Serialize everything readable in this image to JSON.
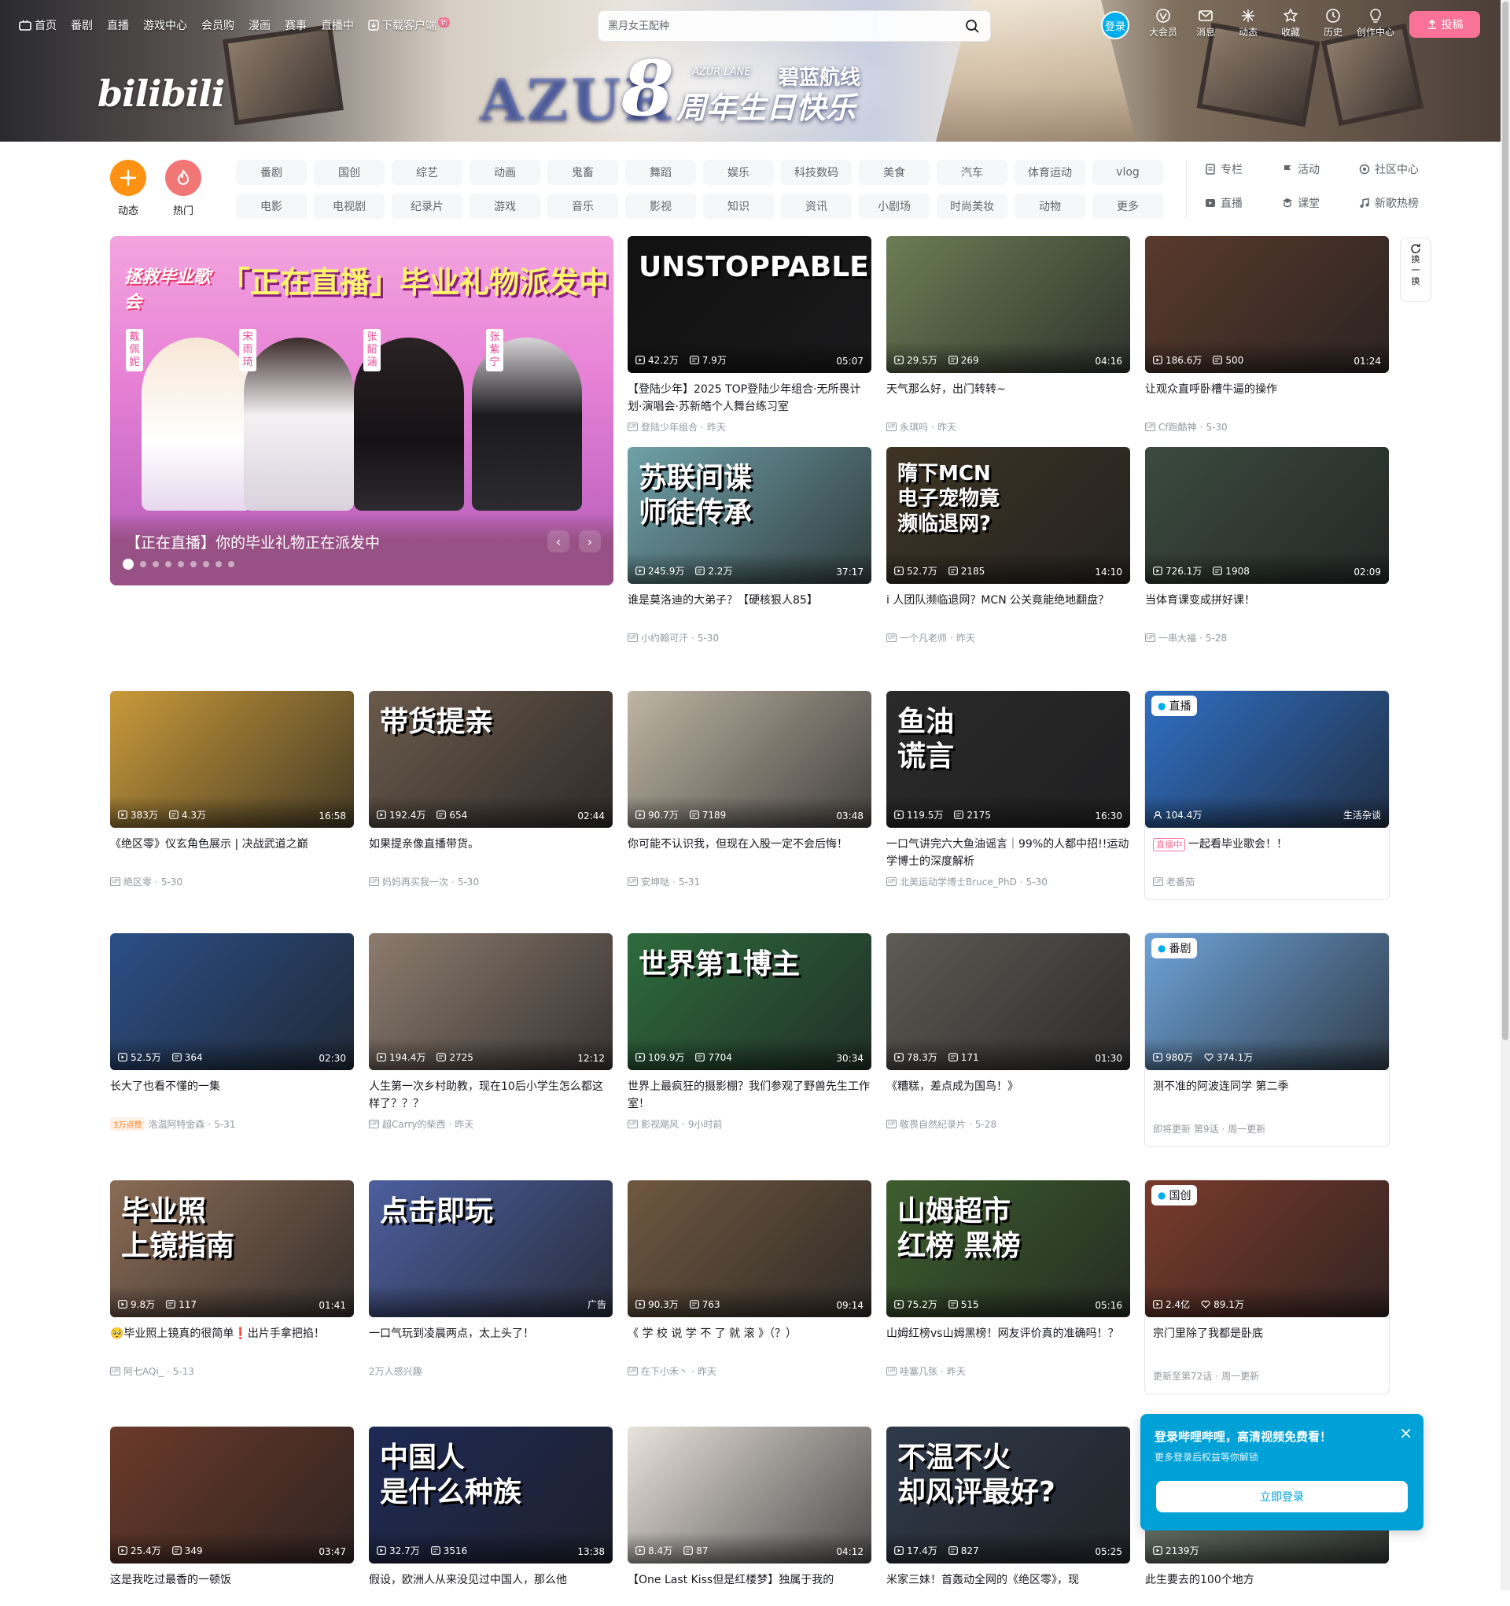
{
  "topnav": {
    "left_items": [
      "首页",
      "番剧",
      "直播",
      "游戏中心",
      "会员购",
      "漫画",
      "赛事",
      "直播中"
    ],
    "download_label": "下载客户端",
    "download_badge": "新",
    "search_placeholder": "黑月女王配种",
    "login_label": "登录",
    "right_items": [
      {
        "label": "大会员",
        "icon": "vip-icon"
      },
      {
        "label": "消息",
        "icon": "message-icon"
      },
      {
        "label": "动态",
        "icon": "dynamic-icon"
      },
      {
        "label": "收藏",
        "icon": "star-icon"
      },
      {
        "label": "历史",
        "icon": "history-icon"
      },
      {
        "label": "创作中心",
        "icon": "bulb-icon"
      }
    ],
    "upload_label": "投稿"
  },
  "banner": {
    "logo": "bilibili",
    "azur_big": "AZUR",
    "eight": "8",
    "sub_en": "AZUR LANE",
    "sub_cn": "碧蓝航线",
    "sub_main": "周年生日快乐"
  },
  "channels": {
    "big": [
      {
        "label": "动态",
        "color": "#ff9212"
      },
      {
        "label": "热门",
        "color": "#f07775"
      }
    ],
    "grid": [
      "番剧",
      "国创",
      "综艺",
      "动画",
      "鬼畜",
      "舞蹈",
      "娱乐",
      "科技数码",
      "美食",
      "汽车",
      "体育运动",
      "vlog",
      "电影",
      "电视剧",
      "纪录片",
      "游戏",
      "音乐",
      "影视",
      "知识",
      "资讯",
      "小剧场",
      "时尚美妆",
      "动物",
      "更多"
    ],
    "right": [
      "专栏",
      "活动",
      "社区中心",
      "直播",
      "课堂",
      "新歌热榜"
    ]
  },
  "carousel": {
    "headline": "「正在直播」毕业礼物派发中",
    "logo": "拯救毕业歌会",
    "singers": [
      "戴佩妮",
      "宋雨琦",
      "张韶涵",
      "张紫宁"
    ],
    "caption": "【正在直播】你的毕业礼物正在派发中",
    "prev": "‹",
    "next": "›"
  },
  "refresh_label": [
    "换",
    "一",
    "换"
  ],
  "videos": [
    {
      "views": "42.2万",
      "danmaku": "7.9万",
      "duration": "05:07",
      "title": "【登陆少年】2025 TOP登陆少年组合·无所畏计划·演唱会·苏新皓个人舞台练习室",
      "up": "登陆少年组合",
      "date": "昨天",
      "overlay": "UNSTOPPABLE",
      "bg": "#111111"
    },
    {
      "views": "29.5万",
      "danmaku": "269",
      "duration": "04:16",
      "title": "天气那么好，出门转转~",
      "up": "永琪吗",
      "date": "昨天",
      "overlay": "",
      "bg": "#6b7d55"
    },
    {
      "views": "186.6万",
      "danmaku": "500",
      "duration": "01:24",
      "title": "让观众直呼卧槽牛逼的操作",
      "up": "Cf跑酷神",
      "date": "5-30",
      "overlay": "",
      "bg": "#5a3a2c"
    },
    {
      "views": "245.9万",
      "danmaku": "2.2万",
      "duration": "37:17",
      "title": "谁是莫洛迪的大弟子？【硬核狠人85】",
      "up": "小约翰可汗",
      "date": "5-30",
      "overlay": "苏联间谍\n师徒传承",
      "bg": "#6fa1a8"
    },
    {
      "views": "52.7万",
      "danmaku": "2185",
      "duration": "14:10",
      "title": "i 人团队濒临退网？MCN 公关竟能绝地翻盘？",
      "up": "一个凡老师",
      "date": "昨天",
      "overlay": "隋下MCN\n电子宠物竟\n濒临退网?",
      "bg": "#3e3424"
    },
    {
      "views": "726.1万",
      "danmaku": "1908",
      "duration": "02:09",
      "title": "当体育课变成拼好课！",
      "up": "一串大福",
      "date": "5-28",
      "overlay": "",
      "bg": "#3b4b3f"
    },
    {
      "views": "383万",
      "danmaku": "4.3万",
      "duration": "16:58",
      "title": "《绝区零》仪玄角色展示 | 决战武道之巅",
      "up": "绝区零",
      "date": "5-30",
      "overlay": "",
      "bg": "#c99a3a"
    },
    {
      "views": "192.4万",
      "danmaku": "654",
      "duration": "02:44",
      "title": "如果提亲像直播带货。",
      "up": "妈妈再买我一次",
      "date": "5-30",
      "overlay": "带货提亲",
      "bg": "#6a5a4b"
    },
    {
      "views": "90.7万",
      "danmaku": "7189",
      "duration": "03:48",
      "title": "你可能不认识我，但现在入股一定不会后悔！",
      "up": "安坤哒",
      "date": "5-31",
      "overlay": "",
      "bg": "#bfb6a4"
    },
    {
      "views": "119.5万",
      "danmaku": "2175",
      "duration": "16:30",
      "title": "一口气讲完六大鱼油谣言｜99%的人都中招!!运动学博士的深度解析",
      "up": "北美运动学博士Bruce_PhD",
      "date": "5-30",
      "overlay": "鱼油\n谎言",
      "bg": "#2a2a2a"
    },
    {
      "live": true,
      "views": "104.4万",
      "area": "生活杂谈",
      "title": "一起看毕业歌会！！",
      "live_tag": "直播中",
      "corner": "直播",
      "up": "老番茄",
      "bg": "#2f6fc4"
    },
    {
      "views": "52.5万",
      "danmaku": "364",
      "duration": "02:30",
      "title": "长大了也看不懂的一集",
      "up": "洛温阿特金森",
      "date": "5-31",
      "hot": "3万点赞",
      "overlay": "",
      "bg": "#2b4f87"
    },
    {
      "views": "194.4万",
      "danmaku": "2725",
      "duration": "12:12",
      "title": "人生第一次乡村助教，现在10后小学生怎么都这样了？？？",
      "up": "超Carry的柴西",
      "date": "昨天",
      "overlay": "",
      "bg": "#8d7c6e"
    },
    {
      "views": "109.9万",
      "danmaku": "7704",
      "duration": "30:34",
      "title": "世界上最疯狂的摄影棚？我们参观了野兽先生工作室！",
      "up": "影视飓风",
      "date": "9小时前",
      "overlay": "世界第1博主",
      "bg": "#2e6b3d"
    },
    {
      "views": "78.3万",
      "danmaku": "171",
      "duration": "01:30",
      "title": "《糟糕，差点成为国鸟！》",
      "up": "敬畏自然纪录片",
      "date": "5-28",
      "overlay": "",
      "bg": "#5e5a54"
    },
    {
      "bangumi": true,
      "views": "980万",
      "likes": "374.1万",
      "title": "测不准的阿波连同学 第二季",
      "update": "即将更新 第9话",
      "freq": "周一更新",
      "corner": "番剧",
      "bg": "#6ea3d8"
    },
    {
      "views": "9.8万",
      "danmaku": "117",
      "duration": "01:41",
      "title": "🥺毕业照上镜真的很简单❗出片手拿把掐！",
      "up": "阿七AQi_",
      "date": "5-13",
      "overlay": "毕业照\n上镜指南",
      "bg": "#8a6b55"
    },
    {
      "ad": true,
      "views": "",
      "danmaku": "",
      "duration": "",
      "title": "一口气玩到凌晨两点，太上头了！",
      "sub": "2万人感兴趣",
      "ad_label": "广告",
      "overlay": "点击即玩",
      "bg": "#4c5f9e"
    },
    {
      "views": "90.3万",
      "danmaku": "763",
      "duration": "09:14",
      "title": "《 学 校 说 学 不 了 就 滚 》（？）",
      "up": "在下小禾丶",
      "date": "昨天",
      "overlay": "",
      "bg": "#6f5840"
    },
    {
      "views": "75.2万",
      "danmaku": "515",
      "duration": "05:16",
      "title": "山姆红榜vs山姆黑榜！网友评价真的准确吗！？",
      "up": "哇塞几张",
      "date": "昨天",
      "overlay": "山姆超市\n红榜  黑榜",
      "bg": "#3d5e2e"
    },
    {
      "guochuang": true,
      "views": "2.4亿",
      "likes": "89.1万",
      "title": "宗门里除了我都是卧底",
      "update": "更新至第72话",
      "freq": "周一更新",
      "corner": "国创",
      "bg": "#7a3b2c"
    },
    {
      "views": "25.4万",
      "danmaku": "349",
      "duration": "03:47",
      "title": "这是我吃过最香的一顿饭",
      "up": "",
      "date": "",
      "overlay": "",
      "bg": "#6b3a2a"
    },
    {
      "views": "32.7万",
      "danmaku": "3516",
      "duration": "13:38",
      "title": "假设，欧洲人从来没见过中国人，那么他",
      "up": "",
      "date": "",
      "overlay": "中国人\n是什么种族",
      "bg": "#1e2a55"
    },
    {
      "views": "8.4万",
      "danmaku": "87",
      "duration": "04:12",
      "title": "【One Last Kiss但是红楼梦】独属于我的",
      "up": "",
      "date": "",
      "overlay": "",
      "bg": "#e9e3dc"
    },
    {
      "views": "17.4万",
      "danmaku": "827",
      "duration": "05:25",
      "title": "米家三妹！首轰动全网的《绝区零》，现",
      "up": "",
      "date": "",
      "overlay": "不温不火\n却风评最好?",
      "bg": "#2f3a4a"
    },
    {
      "views": "2139万",
      "danmaku": "",
      "duration": "",
      "title": "此生要去的100个地方",
      "up": "",
      "date": "",
      "overlay": "",
      "bg": "#7a8a7a"
    }
  ],
  "login_popup": {
    "title": "登录哔哩哔哩，高清视频免费看！",
    "subtitle": "更多登录后权益等你解锁",
    "button": "立即登录"
  },
  "colors": {
    "pink": "#fb7299",
    "blue": "#00aeec",
    "text": "#18191c",
    "muted": "#9499a0"
  }
}
